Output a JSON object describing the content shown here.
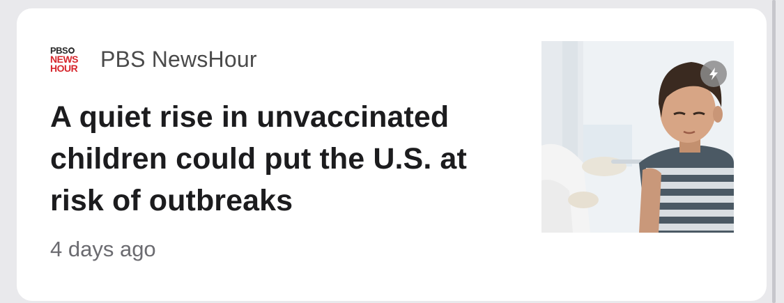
{
  "article": {
    "source": {
      "logo_text_lines": [
        "PBS",
        "NEWS",
        "HOUR"
      ],
      "name": "PBS NewsHour"
    },
    "headline": "A quiet rise in unvaccinated children could put the U.S. at risk of outbreaks",
    "time_ago": "4 days ago",
    "thumbnail": {
      "badge_icon": "lightning-bolt-icon"
    }
  },
  "colors": {
    "logo_red": "#d6262c",
    "headline": "#1c1c1e",
    "source_text": "#4a4a4a",
    "meta_text": "#6b6b70",
    "card_bg": "#ffffff",
    "page_bg": "#e9e9ec"
  }
}
